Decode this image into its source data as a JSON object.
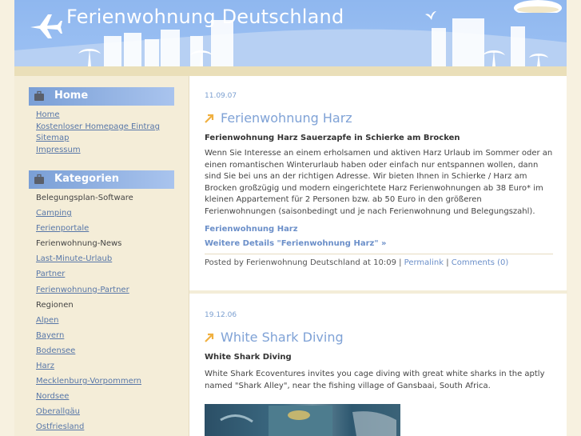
{
  "header": {
    "title": "Ferienwohnung Deutschland"
  },
  "sidebar": {
    "home_heading": "Home",
    "home_links": [
      {
        "label": "Home",
        "link": true
      },
      {
        "label": "Kostenloser Homepage Eintrag",
        "link": true
      },
      {
        "label": "Sitemap",
        "link": true
      },
      {
        "label": "Impressum",
        "link": true
      }
    ],
    "categories_heading": "Kategorien",
    "categories": [
      {
        "label": "Belegungsplan-Software",
        "link": false
      },
      {
        "label": "Camping",
        "link": true
      },
      {
        "label": "Ferienportale",
        "link": true
      },
      {
        "label": "Ferienwohnung-News",
        "link": false
      },
      {
        "label": "Last-Minute-Urlaub",
        "link": true
      },
      {
        "label": "Partner",
        "link": true
      },
      {
        "label": "Ferienwohnung-Partner",
        "link": true
      },
      {
        "label": "Regionen",
        "link": false
      },
      {
        "label": "Alpen",
        "link": true
      },
      {
        "label": "Bayern",
        "link": true
      },
      {
        "label": "Bodensee",
        "link": true
      },
      {
        "label": "Harz",
        "link": true
      },
      {
        "label": "Mecklenburg-Vorpommern",
        "link": true
      },
      {
        "label": "Nordsee",
        "link": true
      },
      {
        "label": "Oberallgäu",
        "link": true
      },
      {
        "label": "Ostfriesland",
        "link": true
      }
    ]
  },
  "posts": [
    {
      "date": "11.09.07",
      "title": "Ferienwohnung Harz",
      "subhead": "Ferienwohnung Harz Sauerzapfe in Schierke am Brocken",
      "body": "Wenn Sie Interesse an einem erholsamen und aktiven Harz Urlaub im Sommer oder an einen romantischen Winterurlaub haben oder einfach nur entspannen wollen, dann sind Sie bei uns an der richtigen Adresse. Wir bieten Ihnen in Schierke / Harz am Brocken großzügig und modern eingerichtete Harz Ferienwohnungen ab 38 Euro* im kleinen Appartement für 2 Personen bzw. ab 50 Euro in den größeren Ferienwohnungen (saisonbedingt und je nach Ferienwohnung und Belegungszahl).",
      "link1": "Ferienwohnung Harz",
      "link2": "Weitere Details \"Ferienwohnung Harz\" »",
      "footer_text": "Posted by Ferienwohnung Deutschland at 10:09 |",
      "permalink": "Permalink",
      "comments": "Comments (0)"
    },
    {
      "date": "19.12.06",
      "title": "White Shark Diving",
      "subhead": "White Shark Diving",
      "body": "White Shark Ecoventures invites you cage diving with great white sharks in the aptly named \"Shark Alley\", near the fishing village of Gansbaai, South Africa."
    }
  ],
  "colors": {
    "sky": "#9fc3f4",
    "sand": "#eadfb9",
    "accent": "#7fa2d6",
    "link": "#5877a8"
  },
  "icons": [
    "airplane-icon",
    "briefcase-icon",
    "arrow-icon",
    "bird-icon",
    "cloud-icon",
    "palm-tree-icon"
  ]
}
